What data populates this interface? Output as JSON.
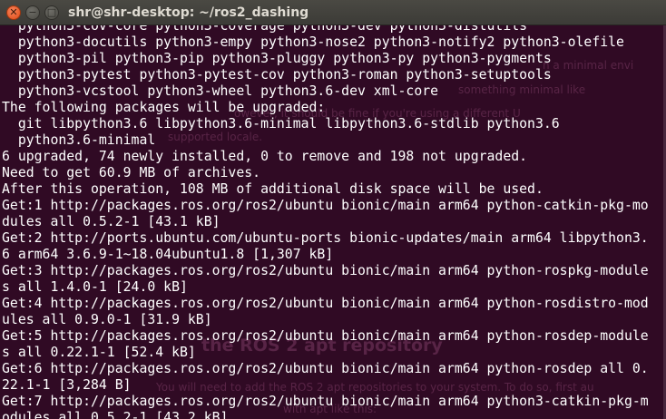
{
  "window": {
    "title": "shr@shr-desktop: ~/ros2_dashing",
    "close_glyph": "✕",
    "minimize_glyph": "−",
    "maximize_glyph": "□"
  },
  "background_page": {
    "fragments": [
      "n a minimal envi",
      "something minimal like",
      "owever, it should be fine if you're using a different U",
      "supported locale.",
      "the ROS 2 apt repository",
      "You will need to add the ROS 2 apt repositories to your system. To do so, first au",
      "with apt like this:"
    ]
  },
  "terminal": {
    "lines": [
      "  python3-cov-core python3-coverage python3-dev python3-distutils",
      "  python3-docutils python3-empy python3-nose2 python3-notify2 python3-olefile",
      "  python3-pil python3-pip python3-pluggy python3-py python3-pygments",
      "  python3-pytest python3-pytest-cov python3-roman python3-setuptools",
      "  python3-vcstool python3-wheel python3.6-dev xml-core",
      "The following packages will be upgraded:",
      "  git libpython3.6 libpython3.6-minimal libpython3.6-stdlib python3.6",
      "  python3.6-minimal",
      "6 upgraded, 74 newly installed, 0 to remove and 198 not upgraded.",
      "Need to get 60.9 MB of archives.",
      "After this operation, 108 MB of additional disk space will be used.",
      "Get:1 http://packages.ros.org/ros2/ubuntu bionic/main arm64 python-catkin-pkg-mo",
      "dules all 0.5.2-1 [43.1 kB]",
      "Get:2 http://ports.ubuntu.com/ubuntu-ports bionic-updates/main arm64 libpython3.",
      "6 arm64 3.6.9-1~18.04ubuntu1.8 [1,307 kB]",
      "Get:3 http://packages.ros.org/ros2/ubuntu bionic/main arm64 python-rospkg-module",
      "s all 1.4.0-1 [24.0 kB]",
      "Get:4 http://packages.ros.org/ros2/ubuntu bionic/main arm64 python-rosdistro-mod",
      "ules all 0.9.0-1 [31.9 kB]",
      "Get:5 http://packages.ros.org/ros2/ubuntu bionic/main arm64 python-rosdep-module",
      "s all 0.22.1-1 [52.4 kB]",
      "Get:6 http://packages.ros.org/ros2/ubuntu bionic/main arm64 python-rosdep all 0.",
      "22.1-1 [3,284 B]",
      "Get:7 http://packages.ros.org/ros2/ubuntu bionic/main arm64 python3-catkin-pkg-m",
      "odules all 0.5.2-1 [43.2 kB]"
    ]
  }
}
